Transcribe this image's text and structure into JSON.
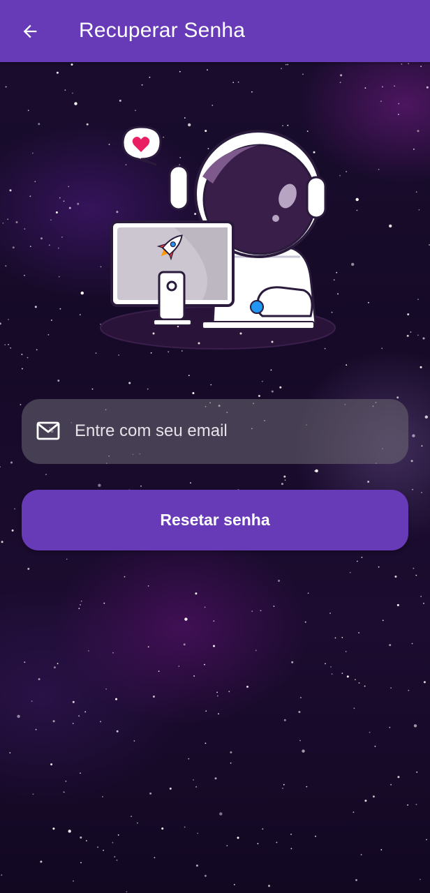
{
  "app_bar": {
    "title": "Recuperar Senha",
    "back_icon": "arrow-left-icon",
    "color": "#673ab7"
  },
  "email_field": {
    "placeholder": "Entre com seu email",
    "value": "",
    "icon": "mail-icon"
  },
  "reset_button": {
    "label": "Resetar senha",
    "color": "#673ab7"
  },
  "illustration": {
    "subject": "astronaut-at-computer",
    "icons": [
      "heart-icon",
      "rocket-icon"
    ],
    "heart_color": "#e91e63"
  }
}
